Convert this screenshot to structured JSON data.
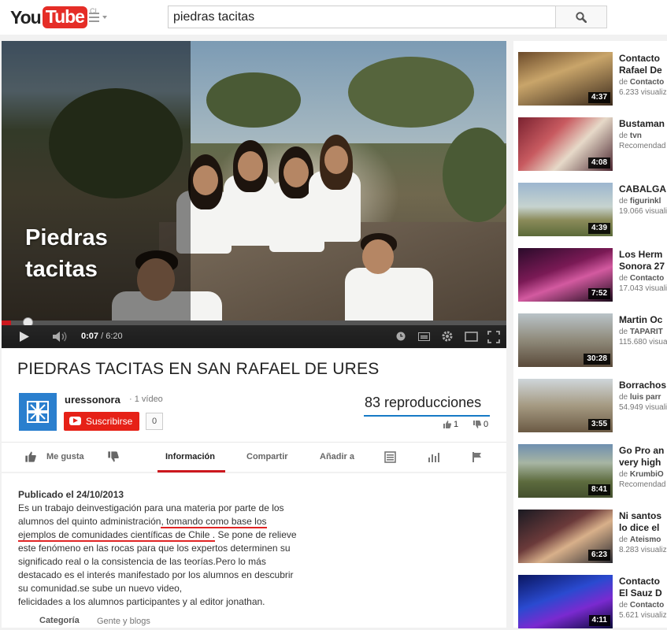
{
  "header": {
    "logo_you": "You",
    "logo_tube": "Tube",
    "region": "CL",
    "search_value": "piedras tacitas",
    "logo_color": "#e52d27"
  },
  "player": {
    "overlay_title_line1": "Piedras",
    "overlay_title_line2": "tacitas",
    "current_time": "0:07",
    "duration": "/ 6:20",
    "progress_fraction": 0.018,
    "accent": "#cc181e"
  },
  "video": {
    "title": "PIEDRAS TACITAS EN SAN RAFAEL DE URES",
    "channel": "uressonora",
    "video_count": "· 1 vídeo",
    "subscribe_label": "Suscribirse",
    "subscriber_count": "0",
    "views": "83 reproducciones",
    "likes": "1",
    "dislikes": "0",
    "actions": {
      "like": "Me gusta",
      "info": "Información",
      "share": "Compartir",
      "add": "Añadir a"
    }
  },
  "description": {
    "published": "Publicado el 24/10/2013",
    "line1": "Es un trabajo deinvestigación para una materia por parte de los",
    "line2_a": "alumnos del quinto administración",
    "line2_b": ", tomando como base los",
    "line3_a": "ejemplos de comunidades científicas de Chile .",
    "line3_b": " Se pone de relieve",
    "line4": "este fenómeno en las rocas para que los expertos determinen su",
    "line5": "significado real o la consistencia de las teorías.Pero lo más",
    "line6": "destacado es el interés manifestado por los alumnos en descubrir",
    "line7": "su comunidad.se sube un nuevo video,",
    "line8": "felicidades a los alumnos participantes y al editor jonathan.",
    "category_label": "Categoría",
    "category_value": "Gente y blogs"
  },
  "related": [
    {
      "title": "Contacto\nRafael De",
      "by": "de Contacto",
      "views": "6.233 visualiz",
      "duration": "4:37"
    },
    {
      "title": "Bustaman",
      "by": "de tvn",
      "views": "Recomendad",
      "duration": "4:08"
    },
    {
      "title": "CABALGA",
      "by": "de figurinkl",
      "views": "19.066 visualiz",
      "duration": "4:39"
    },
    {
      "title": "Los Herm\nSonora 27",
      "by": "de Contacto",
      "views": "17.043 visualiz",
      "duration": "7:52"
    },
    {
      "title": "Martin Oc",
      "by": "de TAPARIT",
      "views": "115.680 visualiz",
      "duration": "30:28"
    },
    {
      "title": "Borrachos",
      "by": "de luis parr",
      "views": "54.949 visualiz",
      "duration": "3:55"
    },
    {
      "title": "Go Pro an\nvery high",
      "by": "de KrumbiO",
      "views": "Recomendad",
      "duration": "8:41"
    },
    {
      "title": "Ni santos\nlo dice el",
      "by": "de Ateismo",
      "views": "8.283 visualiz",
      "duration": "6:23"
    },
    {
      "title": "Contacto\nEl Sauz D",
      "by": "de Contacto",
      "views": "5.621 visualiz",
      "duration": "4:11"
    }
  ]
}
